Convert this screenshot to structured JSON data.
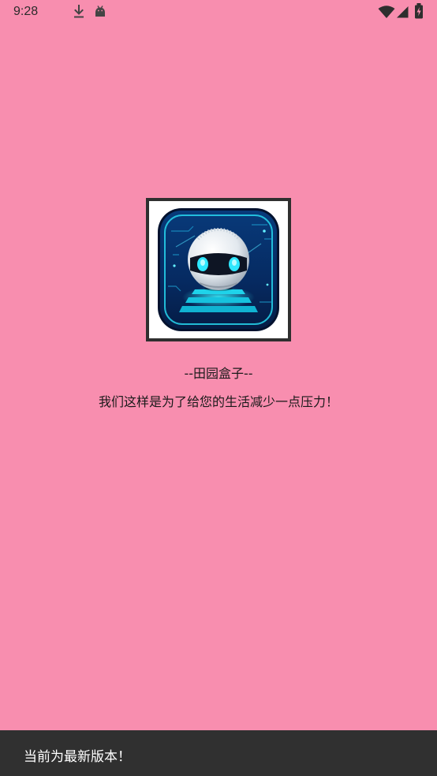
{
  "status_bar": {
    "time": "9:28",
    "icons": [
      "download-icon",
      "android-icon",
      "wifi-icon",
      "signal-icon",
      "battery-icon"
    ]
  },
  "app": {
    "logo_icon": "robot-logo-icon",
    "title": "--田园盒子--",
    "slogan": "我们这样是为了给您的生活减少一点压力！"
  },
  "toast": {
    "message": "当前为最新版本！"
  },
  "colors": {
    "background": "#f88eaf",
    "toast_background": "#303030",
    "logo_accent": "#27d6ee"
  }
}
